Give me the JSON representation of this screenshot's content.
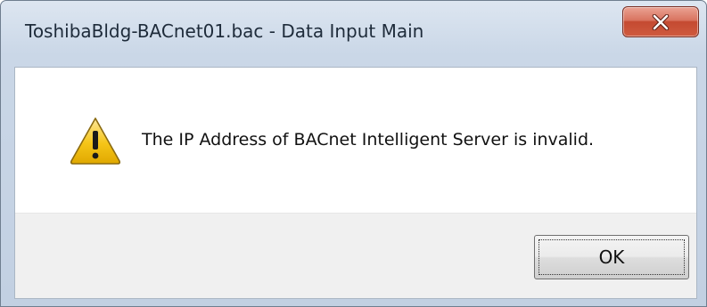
{
  "window": {
    "title": "ToshibaBldg-BACnet01.bac - Data Input Main"
  },
  "dialog": {
    "icon": "warning-icon",
    "message": "The IP Address of BACnet Intelligent Server is invalid.",
    "ok_label": "OK"
  },
  "colors": {
    "close_button": "#c9553c",
    "warning_yellow": "#f5c518",
    "titlebar": "#cad7e7",
    "button_area": "#f0f0f0"
  }
}
